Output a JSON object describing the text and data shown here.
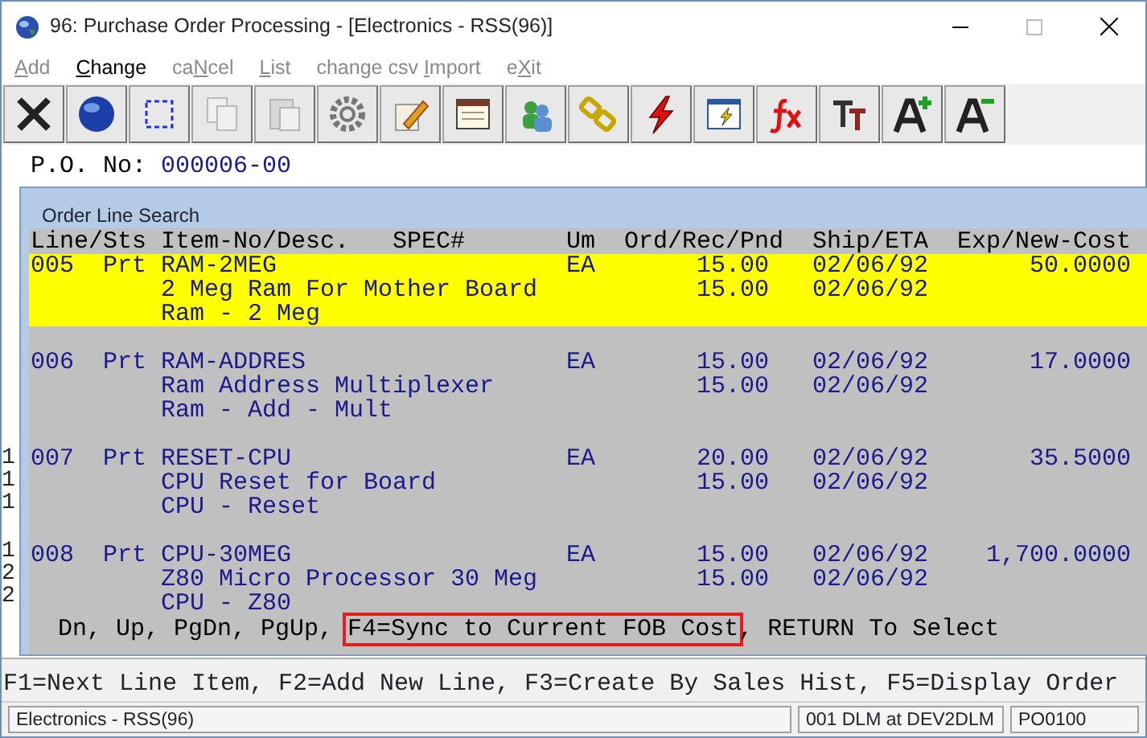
{
  "window": {
    "title": "96: Purchase Order Processing - [Electronics - RSS(96)]"
  },
  "menu": [
    {
      "key": "A",
      "after": "dd",
      "disabled": true
    },
    {
      "key": "C",
      "after": "hange",
      "disabled": false
    },
    {
      "before": "ca",
      "key": "N",
      "after": "cel",
      "disabled": true
    },
    {
      "key": "L",
      "after": "ist",
      "disabled": true
    },
    {
      "before": "change csv ",
      "key": "I",
      "after": "mport",
      "disabled": true
    },
    {
      "before": "e",
      "key": "X",
      "after": "it",
      "disabled": true
    }
  ],
  "toolbar": [
    {
      "disabled": false
    },
    {
      "disabled": false
    },
    {
      "disabled": false
    },
    {
      "disabled": true
    },
    {
      "disabled": true
    },
    {
      "disabled": false
    },
    {
      "disabled": false
    },
    {
      "disabled": false
    },
    {
      "disabled": false
    },
    {
      "disabled": false
    },
    {
      "disabled": false
    },
    {
      "disabled": false
    },
    {
      "disabled": false
    },
    {
      "disabled": false
    },
    {
      "disabled": false
    },
    {
      "disabled": false
    }
  ],
  "po": {
    "label": "P.O. No:",
    "value": "000006-00"
  },
  "background_fragments": [
    [
      "1",
      "1",
      "1"
    ],
    [
      "1",
      "2",
      "2"
    ]
  ],
  "dialog": {
    "title": "Order Line Search",
    "columns": [
      "Line/Sts",
      "Item-No/Desc.",
      "SPEC#",
      "Um",
      "Ord/Rec/Pnd",
      "Ship/ETA",
      "Exp/New-Cost"
    ],
    "rows": [
      {
        "line": "005",
        "status": "Prt",
        "item": "RAM-2MEG",
        "um": "EA",
        "ordered": "15.00",
        "ship": "02/06/92",
        "cost": "50.0000",
        "desc": "2 Meg Ram For Mother Board",
        "received": "15.00",
        "eta": "02/06/92",
        "spec": "Ram - 2 Meg",
        "selected": true
      },
      {
        "line": "006",
        "status": "Prt",
        "item": "RAM-ADDRES",
        "um": "EA",
        "ordered": "15.00",
        "ship": "02/06/92",
        "cost": "17.0000",
        "desc": "Ram Address Multiplexer",
        "received": "15.00",
        "eta": "02/06/92",
        "spec": "Ram - Add - Mult",
        "selected": false
      },
      {
        "line": "007",
        "status": "Prt",
        "item": "RESET-CPU",
        "um": "EA",
        "ordered": "20.00",
        "ship": "02/06/92",
        "cost": "35.5000",
        "desc": "CPU Reset for Board",
        "received": "15.00",
        "eta": "02/06/92",
        "spec": "CPU - Reset",
        "selected": false
      },
      {
        "line": "008",
        "status": "Prt",
        "item": "CPU-30MEG",
        "um": "EA",
        "ordered": "15.00",
        "ship": "02/06/92",
        "cost": "1,700.0000",
        "desc": "Z80 Micro Processor 30 Meg",
        "received": "15.00",
        "eta": "02/06/92",
        "spec": "CPU - Z80",
        "selected": false
      }
    ],
    "hint": [
      {
        "text": "Dn, Up, PgDn, PgUp, ",
        "highlighted": false
      },
      {
        "text": "F4=Sync to Current FOB Cost",
        "highlighted": true
      },
      {
        "text": ", RETURN To Select",
        "highlighted": false
      }
    ]
  },
  "function_keys": "F1=Next Line Item, F2=Add New Line, F3=Create By Sales Hist, F5=Display Order",
  "status_bar": [
    "Electronics - RSS(96)",
    "001 DLM at DEV2DLM",
    "PO0100"
  ]
}
